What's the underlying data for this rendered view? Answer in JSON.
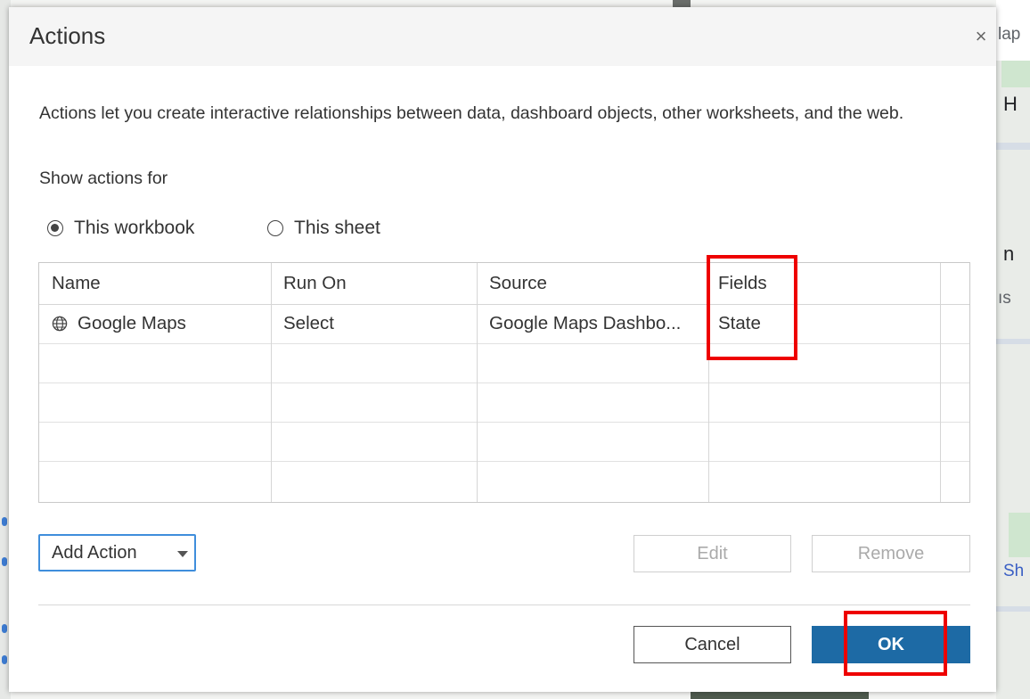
{
  "dialog": {
    "title": "Actions",
    "close_symbol": "×",
    "description": "Actions let you create interactive relationships between data, dashboard objects, other worksheets, and the web.",
    "show_actions_label": "Show actions for",
    "scope_options": [
      {
        "label": "This workbook",
        "selected": true
      },
      {
        "label": "This sheet",
        "selected": false
      }
    ],
    "table": {
      "columns": [
        "Name",
        "Run On",
        "Source",
        "Fields"
      ],
      "rows": [
        {
          "name": "Google Maps",
          "name_icon": "globe-icon",
          "run_on": "Select",
          "source": "Google Maps Dashbo...",
          "fields": "State"
        }
      ]
    },
    "buttons": {
      "add_action": "Add Action",
      "edit": "Edit",
      "remove": "Remove",
      "cancel": "Cancel",
      "ok": "OK"
    }
  },
  "background": {
    "partial_texts": [
      "lap",
      "H",
      "n",
      "ıs",
      "Sh"
    ]
  },
  "colors": {
    "ok_button": "#1d6aa5",
    "highlight": "#ee0000",
    "focus_border": "#3f8edc"
  }
}
